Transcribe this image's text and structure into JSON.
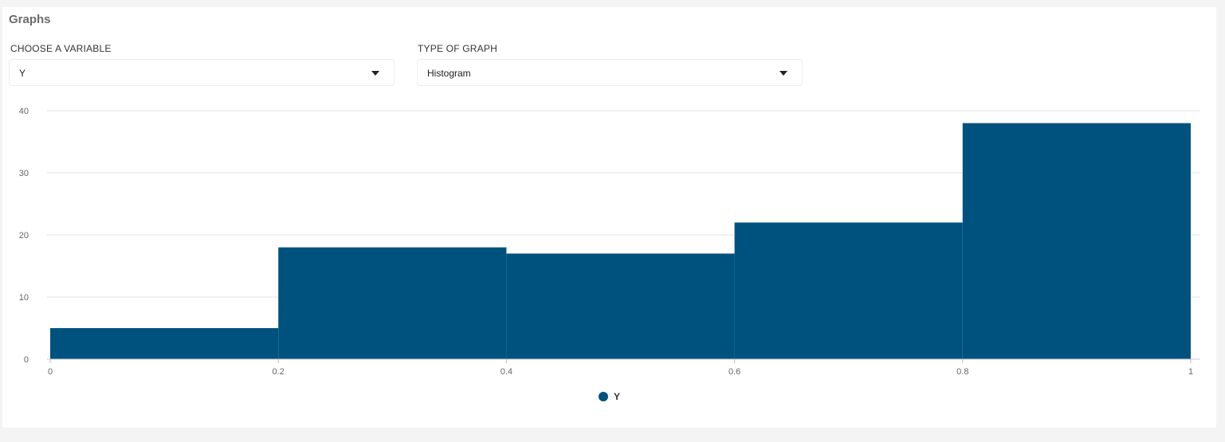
{
  "panel": {
    "title": "Graphs"
  },
  "variable_select": {
    "label": "CHOOSE A VARIABLE",
    "value": "Y"
  },
  "graph_type_select": {
    "label": "TYPE OF GRAPH",
    "value": "Histogram"
  },
  "chart_data": {
    "type": "bar",
    "bins": [
      {
        "x0": 0,
        "x1": 0.2,
        "value": 5
      },
      {
        "x0": 0.2,
        "x1": 0.4,
        "value": 18
      },
      {
        "x0": 0.4,
        "x1": 0.6,
        "value": 17
      },
      {
        "x0": 0.6,
        "x1": 0.8,
        "value": 22
      },
      {
        "x0": 0.8,
        "x1": 1.0,
        "value": 38
      }
    ],
    "x_ticks": [
      "0",
      "0.2",
      "0.4",
      "0.6",
      "0.8",
      "1"
    ],
    "y_ticks": [
      "0",
      "10",
      "20",
      "30",
      "40"
    ],
    "xlim": [
      0,
      1
    ],
    "ylim": [
      0,
      40
    ],
    "grid": true,
    "legend": {
      "placement": "bottom-center",
      "entries": [
        "Y"
      ]
    },
    "colors": {
      "bar": "#00527e"
    }
  }
}
